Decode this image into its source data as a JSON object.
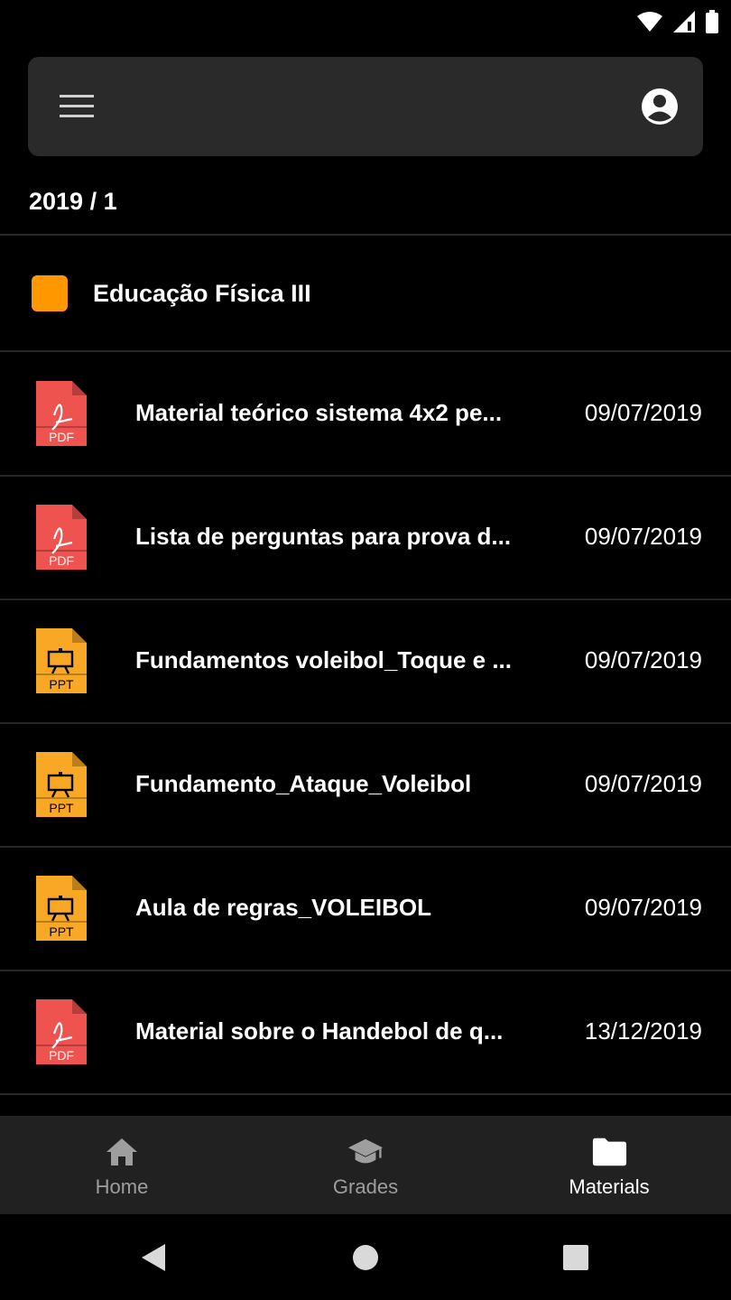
{
  "colors": {
    "background": "#000000",
    "appbar": "#2a2a2a",
    "course_swatch": "#ff9800",
    "pdf": "#ef5350",
    "ppt": "#f9a825",
    "nav_active": "#ffffff",
    "nav_inactive": "#9e9e9e"
  },
  "status_bar": {
    "icons": [
      "wifi-icon",
      "signal-icon",
      "battery-icon"
    ]
  },
  "appbar": {
    "menu_icon": "menu-icon",
    "account_icon": "account-circle-icon"
  },
  "semester": "2019 / 1",
  "course": {
    "title": "Educação Física III"
  },
  "materials": [
    {
      "type": "PDF",
      "name": "Material teórico sistema 4x2 pe...",
      "date": "09/07/2019"
    },
    {
      "type": "PDF",
      "name": "Lista de perguntas para prova d...",
      "date": "09/07/2019"
    },
    {
      "type": "PPT",
      "name": "Fundamentos voleibol_Toque e ...",
      "date": "09/07/2019"
    },
    {
      "type": "PPT",
      "name": "Fundamento_Ataque_Voleibol",
      "date": "09/07/2019"
    },
    {
      "type": "PPT",
      "name": "Aula de regras_VOLEIBOL",
      "date": "09/07/2019"
    },
    {
      "type": "PDF",
      "name": "Material sobre o Handebol de q...",
      "date": "13/12/2019"
    }
  ],
  "bottom_nav": {
    "items": [
      {
        "label": "Home",
        "icon": "home-icon",
        "active": false
      },
      {
        "label": "Grades",
        "icon": "graduation-cap-icon",
        "active": false
      },
      {
        "label": "Materials",
        "icon": "folder-icon",
        "active": true
      }
    ]
  },
  "system_nav": [
    "back-icon",
    "home-circle-icon",
    "recents-icon"
  ]
}
